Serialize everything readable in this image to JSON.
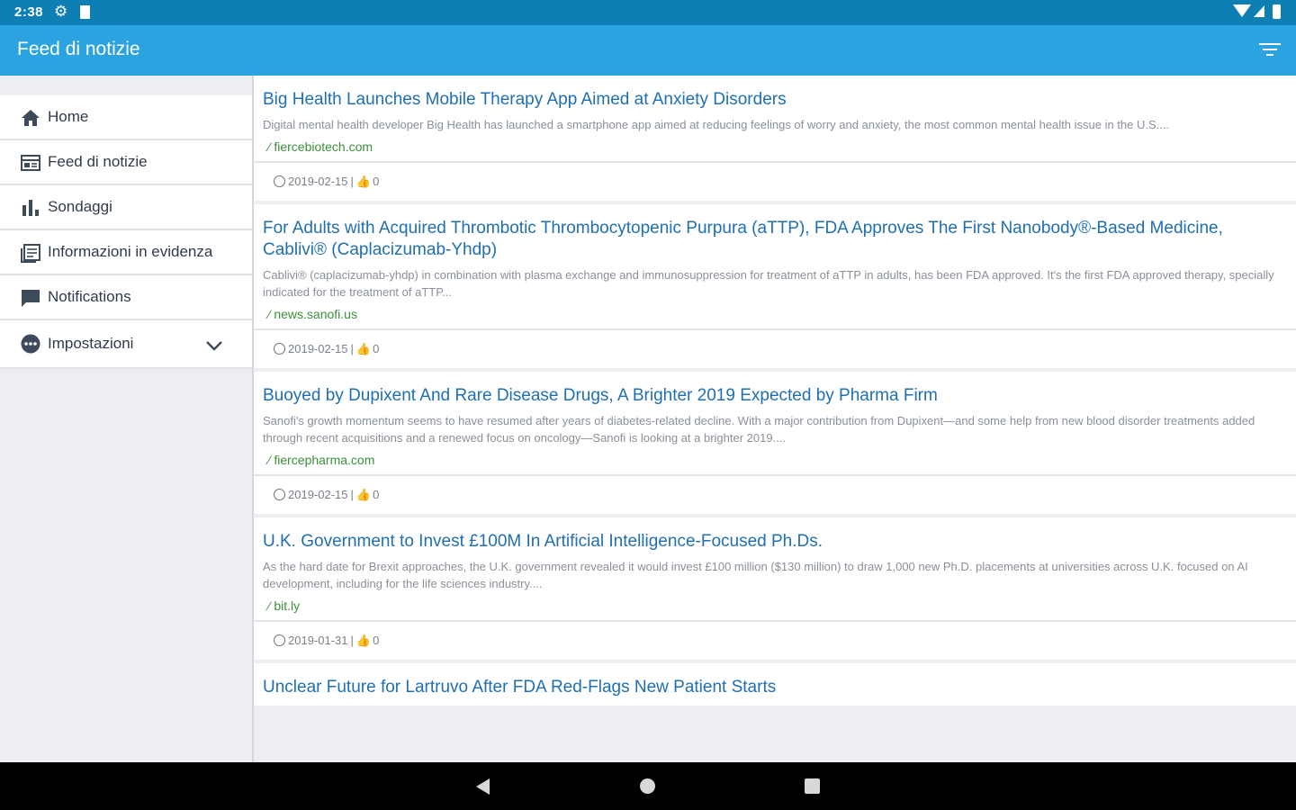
{
  "status_bar": {
    "time": "2:38"
  },
  "app_bar": {
    "title": "Feed di notizie"
  },
  "sidebar": {
    "items": [
      {
        "label": "Home",
        "icon": "home-icon"
      },
      {
        "label": "Feed di notizie",
        "icon": "feed-icon"
      },
      {
        "label": "Sondaggi",
        "icon": "bar-chart-icon"
      },
      {
        "label": "Informazioni in evidenza",
        "icon": "article-icon"
      },
      {
        "label": "Notifications",
        "icon": "message-icon"
      },
      {
        "label": "Impostazioni",
        "icon": "more-icon",
        "expandable": true
      }
    ]
  },
  "feed": {
    "articles": [
      {
        "title": "Big Health Launches Mobile Therapy App Aimed at Anxiety Disorders",
        "summary": "Digital mental health developer Big Health has launched a smartphone app aimed at reducing feelings of worry and anxiety, the most common mental health issue in the U.S....",
        "source": "fiercebiotech.com",
        "date": "2019-02-15",
        "likes": "0"
      },
      {
        "title": "For Adults with Acquired Thrombotic Thrombocytopenic Purpura (aTTP), FDA Approves The First Nanobody®-Based Medicine, Cablivi® (Caplacizumab-Yhdp)",
        "summary": "Cablivi® (caplacizumab-yhdp) in combination with plasma exchange and immunosuppression for treatment of aTTP in adults, has been FDA approved.  It's the first FDA approved therapy, specially indicated for the treatment of aTTP...",
        "source": "news.sanofi.us",
        "date": "2019-02-15",
        "likes": "0"
      },
      {
        "title": "Buoyed by Dupixent And Rare Disease Drugs, A Brighter 2019 Expected by Pharma Firm",
        "summary": "Sanofi's growth momentum seems to have resumed after years of diabetes-related decline. With a major contribution from Dupixent—and some help from new blood disorder treatments added through recent acquisitions and a renewed focus on oncology—Sanofi is looking at a brighter 2019....",
        "source": "fiercepharma.com",
        "date": "2019-02-15",
        "likes": "0"
      },
      {
        "title": "U.K. Government to Invest £100M In Artificial Intelligence-Focused Ph.Ds.",
        "summary": "As the hard date for Brexit approaches, the U.K. government revealed it would invest £100 million ($130 million) to draw 1,000 new Ph.D. placements at universities across U.K. focused on AI development, including for the life sciences industry....",
        "source": "bit.ly",
        "date": "2019-01-31",
        "likes": "0"
      },
      {
        "title": "Unclear Future for Lartruvo After FDA Red-Flags New Patient Starts",
        "summary": "",
        "source": "",
        "date": "",
        "likes": ""
      }
    ]
  },
  "colors": {
    "status_bar": "#0e7fb4",
    "app_bar": "#2aa3e0",
    "headline": "#1f6fb2",
    "source": "#3a8f3a"
  }
}
